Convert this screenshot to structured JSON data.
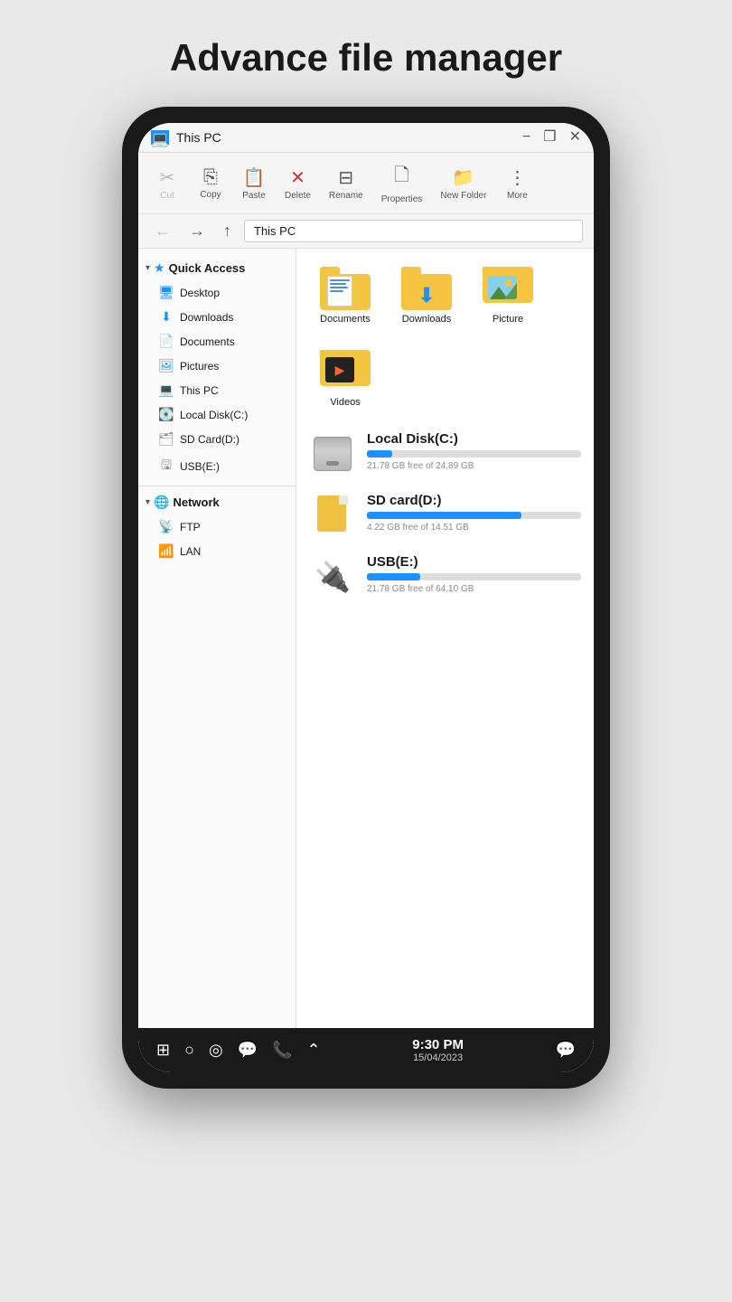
{
  "page": {
    "title": "Advance file manager"
  },
  "titlebar": {
    "icon": "💻",
    "text": "This PC",
    "minimize": "−",
    "maximize": "❐",
    "close": "✕"
  },
  "toolbar": {
    "cut": "Cut",
    "copy": "Copy",
    "paste": "Paste",
    "delete": "Delete",
    "rename": "Rename",
    "properties": "Properties",
    "new_folder": "New Folder",
    "more": "More"
  },
  "navbar": {
    "back": "←",
    "forward": "→",
    "up": "↑",
    "location": "This PC"
  },
  "sidebar": {
    "quick_access_label": "Quick Access",
    "desktop_label": "Desktop",
    "downloads_label": "Downloads",
    "documents_label": "Documents",
    "pictures_label": "Pictures",
    "this_pc_label": "This PC",
    "local_disk_label": "Local Disk(C:)",
    "sd_card_label": "SD Card(D:)",
    "usb_label": "USB(E:)",
    "network_label": "Network",
    "ftp_label": "FTP",
    "lan_label": "LAN"
  },
  "files": {
    "folders": [
      {
        "name": "Documents",
        "type": "documents"
      },
      {
        "name": "Downloads",
        "type": "downloads"
      },
      {
        "name": "Picture",
        "type": "pictures"
      },
      {
        "name": "Videos",
        "type": "videos"
      }
    ],
    "drives": [
      {
        "name": "Local Disk(C:)",
        "type": "hdd",
        "free": "21.78 GB free of 24.89 GB",
        "fill_pct": 12,
        "fill_class": "large"
      },
      {
        "name": "SD card(D:)",
        "type": "sd",
        "free": "4.22 GB free of 14.51 GB",
        "fill_pct": 72,
        "fill_class": "medium"
      },
      {
        "name": "USB(E:)",
        "type": "usb",
        "free": "21.78 GB free of 64.10 GB",
        "fill_pct": 25,
        "fill_class": "small"
      }
    ]
  },
  "statusbar": {
    "time": "9:30 PM",
    "date": "15/04/2023"
  }
}
